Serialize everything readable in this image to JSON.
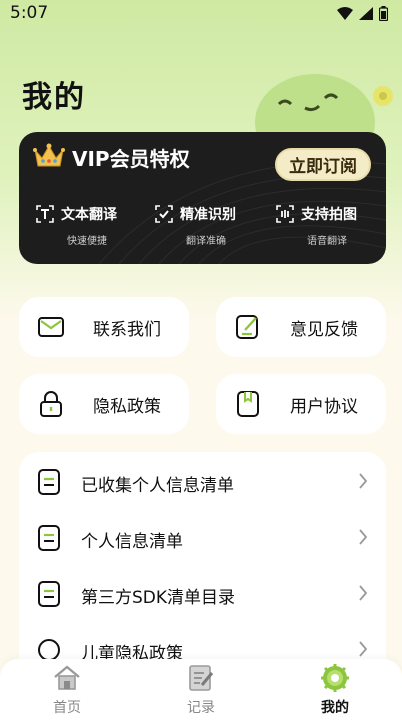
{
  "status_bar": {
    "time": "5:07"
  },
  "header": {
    "title": "我的"
  },
  "vip": {
    "title": "VIP会员特权",
    "subscribe_label": "立即订阅",
    "features": [
      {
        "icon": "text-translate-icon",
        "label": "文本翻译",
        "sub": "快速便捷"
      },
      {
        "icon": "precise-recognize-icon",
        "label": "精准识别",
        "sub": "翻译准确"
      },
      {
        "icon": "camera-scan-icon",
        "label": "支持拍图",
        "sub": "语音翻译"
      }
    ]
  },
  "tiles": [
    {
      "icon": "mail-icon",
      "label": "联系我们"
    },
    {
      "icon": "feedback-icon",
      "label": "意见反馈"
    },
    {
      "icon": "lock-icon",
      "label": "隐私政策"
    },
    {
      "icon": "bookmark-doc-icon",
      "label": "用户协议"
    }
  ],
  "list": [
    {
      "icon": "document-icon",
      "label": "已收集个人信息清单"
    },
    {
      "icon": "document-icon",
      "label": "个人信息清单"
    },
    {
      "icon": "document-icon",
      "label": "第三方SDK清单目录"
    },
    {
      "icon": "circle-icon",
      "label": "儿童隐私政策"
    }
  ],
  "tabbar": {
    "items": [
      {
        "icon": "home-icon",
        "label": "首页"
      },
      {
        "icon": "record-icon",
        "label": "记录"
      },
      {
        "icon": "profile-gear-icon",
        "label": "我的"
      }
    ],
    "active": "我的"
  },
  "colors": {
    "accent": "#8cc63f",
    "hero": "#cfe9a3",
    "background": "#fdf9ec",
    "vip_card": "#1d1d1d",
    "subscribe": "#f4ecc6"
  }
}
